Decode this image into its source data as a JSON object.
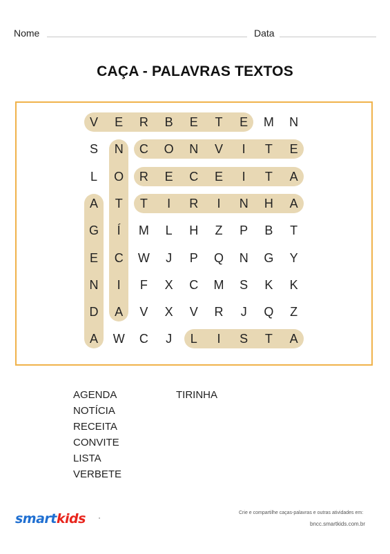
{
  "header": {
    "name_label": "Nome",
    "date_label": "Data"
  },
  "title": "CAÇA - PALAVRAS TEXTOS",
  "grid": [
    [
      "V",
      "E",
      "R",
      "B",
      "E",
      "T",
      "E",
      "M",
      "N"
    ],
    [
      "S",
      "N",
      "C",
      "O",
      "N",
      "V",
      "I",
      "T",
      "E"
    ],
    [
      "L",
      "O",
      "R",
      "E",
      "C",
      "E",
      "I",
      "T",
      "A"
    ],
    [
      "A",
      "T",
      "T",
      "I",
      "R",
      "I",
      "N",
      "H",
      "A"
    ],
    [
      "G",
      "Í",
      "M",
      "L",
      "H",
      "Z",
      "P",
      "B",
      "T"
    ],
    [
      "E",
      "C",
      "W",
      "J",
      "P",
      "Q",
      "N",
      "G",
      "Y"
    ],
    [
      "N",
      "I",
      "F",
      "X",
      "C",
      "M",
      "S",
      "K",
      "K"
    ],
    [
      "D",
      "A",
      "V",
      "X",
      "V",
      "R",
      "J",
      "Q",
      "Z"
    ],
    [
      "A",
      "W",
      "C",
      "J",
      "L",
      "I",
      "S",
      "T",
      "A"
    ]
  ],
  "found_words": [
    {
      "word": "VERBETE",
      "direction": "horizontal",
      "row": 0,
      "col": 0,
      "length": 7
    },
    {
      "word": "CONVITE",
      "direction": "horizontal",
      "row": 1,
      "col": 2,
      "length": 7
    },
    {
      "word": "RECEITA",
      "direction": "horizontal",
      "row": 2,
      "col": 2,
      "length": 7
    },
    {
      "word": "TIRINHA",
      "direction": "horizontal",
      "row": 3,
      "col": 2,
      "length": 7
    },
    {
      "word": "LISTA",
      "direction": "horizontal",
      "row": 8,
      "col": 4,
      "length": 5
    },
    {
      "word": "AGENDA",
      "direction": "vertical",
      "row": 3,
      "col": 0,
      "length": 6
    },
    {
      "word": "NOTÍCIA",
      "direction": "vertical",
      "row": 1,
      "col": 1,
      "length": 7
    }
  ],
  "word_list": {
    "column_1": [
      "AGENDA",
      "NOTÍCIA",
      "RECEITA",
      "CONVITE",
      "LISTA",
      "VERBETE"
    ],
    "column_2": [
      "TIRINHA"
    ]
  },
  "footer": {
    "logo_part_1": "smart",
    "logo_part_2": "kids",
    "caption": "Crie e compartilhe caças-palavras e outras atividades em:",
    "url": "bncc.smartkids.com.br"
  },
  "colors": {
    "border": "#f0b24a",
    "highlight": "#e8d8b4",
    "logo_blue": "#1f6fd1",
    "logo_red": "#e8251d"
  }
}
